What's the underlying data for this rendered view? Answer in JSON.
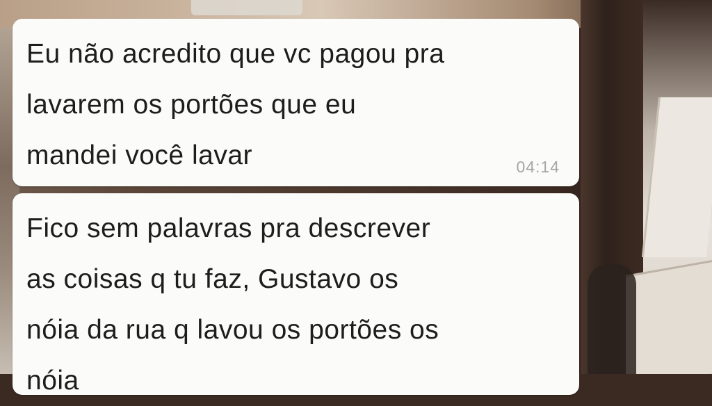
{
  "messages": [
    {
      "text": "Eu não acredito que vc pagou pra\nlavarem os portões que eu\nmandei você lavar",
      "time": "04:14"
    },
    {
      "text": "Fico sem palavras pra descrever\nas coisas q tu faz, Gustavo os\nnóia da rua q lavou os portões os\nnóia"
    }
  ],
  "colors": {
    "bubble_background": "#fbfbfa",
    "message_text": "#1d1d1d",
    "timestamp_text": "#a6a6a6"
  }
}
